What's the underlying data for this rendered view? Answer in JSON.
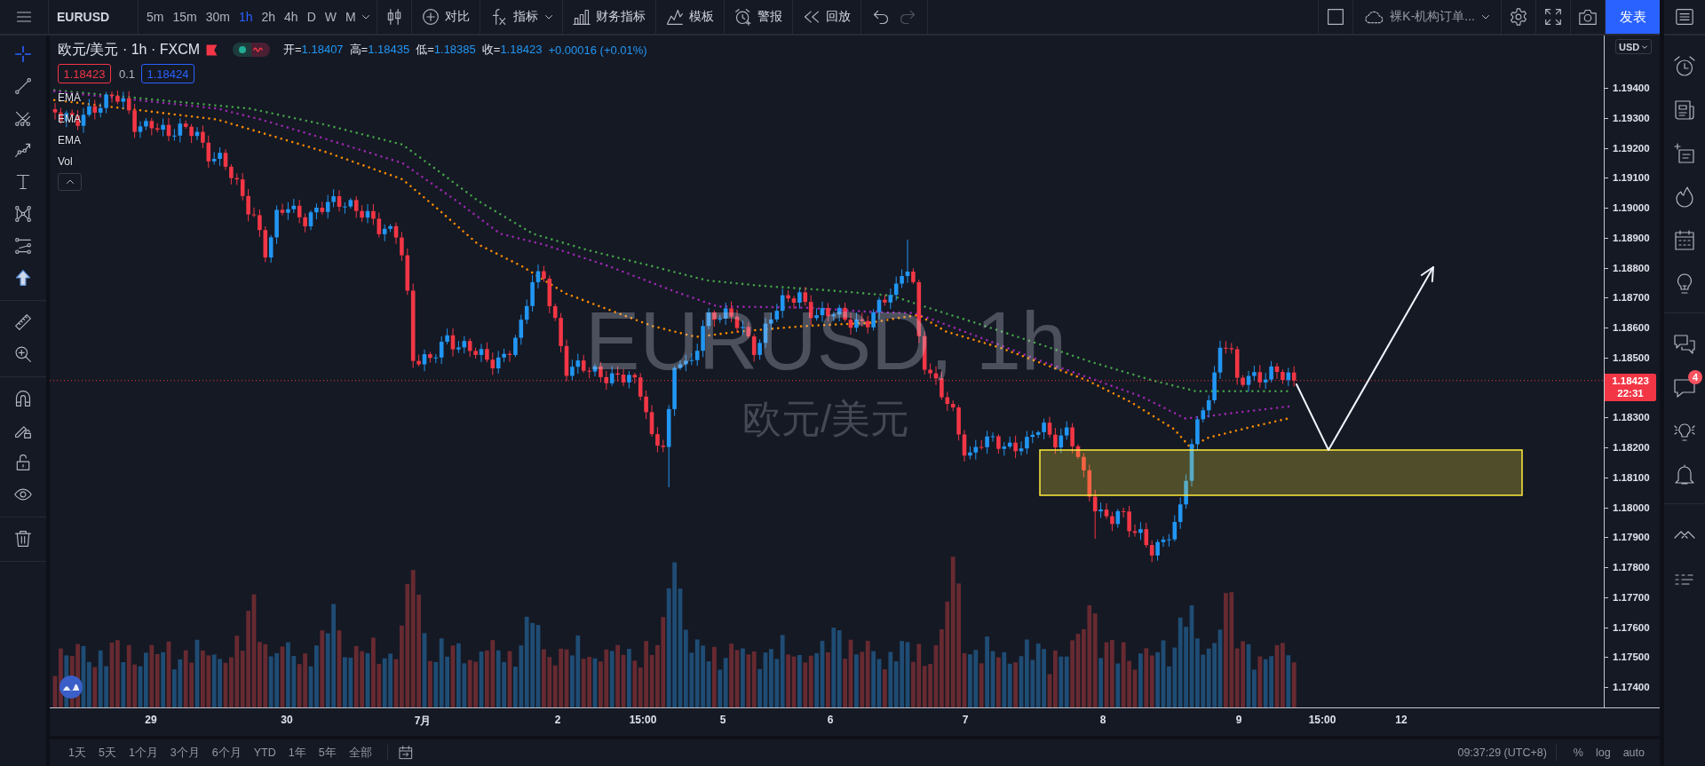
{
  "top_bar": {
    "symbol": "EURUSD",
    "intervals": [
      {
        "label": "5m",
        "selected": false
      },
      {
        "label": "15m",
        "selected": false
      },
      {
        "label": "30m",
        "selected": false
      },
      {
        "label": "1h",
        "selected": true
      },
      {
        "label": "2h",
        "selected": false
      },
      {
        "label": "4h",
        "selected": false
      },
      {
        "label": "D",
        "selected": false
      },
      {
        "label": "W",
        "selected": false
      },
      {
        "label": "M",
        "selected": false
      }
    ],
    "tools": [
      {
        "label": "对比"
      },
      {
        "label": "指标"
      },
      {
        "label": "财务指标"
      },
      {
        "label": "模板"
      },
      {
        "label": "警报"
      },
      {
        "label": "回放"
      }
    ],
    "layout_name": "裸K-机构订单...",
    "publish_button": "发表"
  },
  "left_toolbar": {
    "tools": [
      {
        "selected": true
      },
      {
        "selected": false
      },
      {
        "selected": false
      },
      {
        "selected": false
      },
      {
        "selected": false
      },
      {
        "selected": false
      },
      {
        "selected": false
      },
      {
        "selected": false
      },
      {
        "selected": false
      },
      {
        "selected": false
      },
      {
        "selected": false
      },
      {
        "selected": false
      },
      {
        "selected": false
      },
      {
        "selected": false
      },
      {
        "selected": false
      }
    ]
  },
  "legend": {
    "title": "欧元/美元 · 1h · FXCM",
    "market_open": true,
    "ohlc": [
      {
        "label": "开=",
        "value": "1.18407"
      },
      {
        "label": "高=",
        "value": "1.18435"
      },
      {
        "label": "低=",
        "value": "1.18385"
      },
      {
        "label": "收=",
        "value": "1.18423"
      }
    ],
    "change": "+0.00016 (+0.01%)",
    "sell_price": "1.18423",
    "spread": "0.1",
    "buy_price": "1.18424",
    "indicators": [
      "EMA",
      "EMA",
      "EMA",
      "Vol"
    ]
  },
  "chart": {
    "watermark_title": "EURUSD, 1h",
    "watermark_subtitle": "欧元/美元"
  },
  "price_axis": {
    "currency": "USD",
    "ticks": [
      "1.19400",
      "1.19300",
      "1.19200",
      "1.19100",
      "1.19000",
      "1.18900",
      "1.18800",
      "1.18700",
      "1.18600",
      "1.18500",
      "1.18300",
      "1.18200",
      "1.18100",
      "1.18000",
      "1.17900",
      "1.17800",
      "1.17700",
      "1.17600",
      "1.17500",
      "1.17400"
    ],
    "last_price": "1.18423",
    "countdown": "22:31"
  },
  "time_axis": {
    "labels": [
      "29",
      "30",
      "7月",
      "2",
      "15:00",
      "5",
      "6",
      "7",
      "8",
      "9",
      "15:00",
      "12"
    ]
  },
  "bottom_bar": {
    "ranges": [
      "1天",
      "5天",
      "1个月",
      "3个月",
      "6个月",
      "YTD",
      "1年",
      "5年",
      "全部"
    ],
    "clock": "09:37:29 (UTC+8)",
    "scale_options": [
      "%",
      "log",
      "auto"
    ]
  },
  "right_sidebar": {
    "badge": "4"
  }
}
